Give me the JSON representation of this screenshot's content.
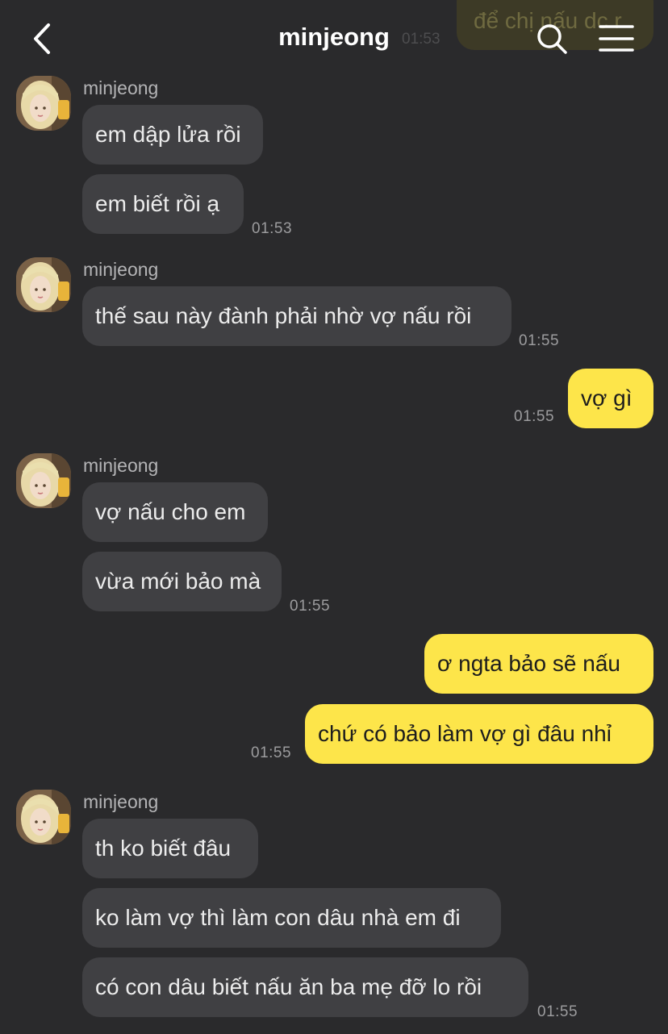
{
  "header": {
    "title": "minjeong",
    "back_icon": "chevron-left-icon",
    "search_icon": "search-icon",
    "menu_icon": "hamburger-menu-icon"
  },
  "ghost": {
    "text": "để chị nấu dc r",
    "time": "01:53"
  },
  "groups": [
    {
      "sender": "minjeong",
      "messages": [
        "em dập lửa rồi",
        "em biết rồi ạ"
      ],
      "time": "01:53"
    },
    {
      "sender": "minjeong",
      "messages": [
        "thế sau này đành phải nhờ vợ nấu rồi"
      ],
      "time": "01:55"
    },
    {
      "outgoing": true,
      "messages": [
        "vợ gì"
      ],
      "time": "01:55"
    },
    {
      "sender": "minjeong",
      "messages": [
        "vợ nấu cho em",
        "vừa mới bảo mà"
      ],
      "time": "01:55"
    },
    {
      "outgoing": true,
      "messages": [
        "ơ ngta bảo sẽ nấu",
        "chứ có bảo làm vợ gì đâu nhỉ"
      ],
      "time": "01:55"
    },
    {
      "sender": "minjeong",
      "messages": [
        "th ko biết đâu",
        "ko làm vợ thì làm con dâu nhà em đi",
        "có con dâu biết nấu ăn ba mẹ đỡ lo rồi"
      ],
      "time": "01:55"
    }
  ],
  "colors": {
    "background": "#2a2a2c",
    "incoming_bubble": "#404043",
    "outgoing_bubble": "#fde54a"
  }
}
